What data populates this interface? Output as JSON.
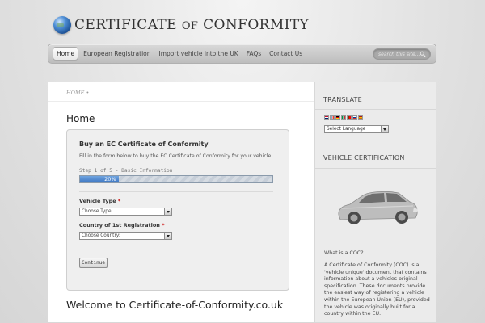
{
  "header": {
    "logo_main": "CERTIFICATE",
    "logo_small": "OF",
    "logo_end": "CONFORMITY"
  },
  "nav": {
    "items": [
      {
        "label": "Home",
        "active": true
      },
      {
        "label": "European Registration",
        "active": false
      },
      {
        "label": "Import vehicle into the UK",
        "active": false
      },
      {
        "label": "FAQs",
        "active": false
      },
      {
        "label": "Contact Us",
        "active": false
      }
    ],
    "search_placeholder": "search this site..."
  },
  "main": {
    "breadcrumb": "HOME •",
    "page_title": "Home",
    "form": {
      "title": "Buy an EC Certificate of Conformity",
      "description": "Fill in the form below to buy the EC Certificate of Conformity for your vehicle.",
      "step_text": "Step 1 of 5 - Basic Information",
      "progress_label": "20%",
      "progress_fraction": 0.2,
      "fields": [
        {
          "label": "Vehicle Type",
          "required_mark": "*",
          "value": "Choose Type:"
        },
        {
          "label": "Country of 1st Registration",
          "required_mark": "*",
          "value": "Choose Country:"
        }
      ],
      "continue_label": "Continue"
    },
    "welcome": "Welcome to Certificate-of-Conformity.co.uk"
  },
  "sidebar": {
    "translate_heading": "TRANSLATE",
    "language_select": "Select Language",
    "vehicle_heading": "VEHICLE CERTIFICATION",
    "question": "What is a COC?",
    "paragraph": "A Certificate of Conformity (COC) is a 'vehicle unique' document that contains information about a vehicles original specification. These documents provide the easiest way of registering a vehicle within the European Union (EU), provided the vehicle was originally built for a country within the EU."
  },
  "colors": {
    "progress_fill": "#4a84cc",
    "required": "#cc0000"
  }
}
